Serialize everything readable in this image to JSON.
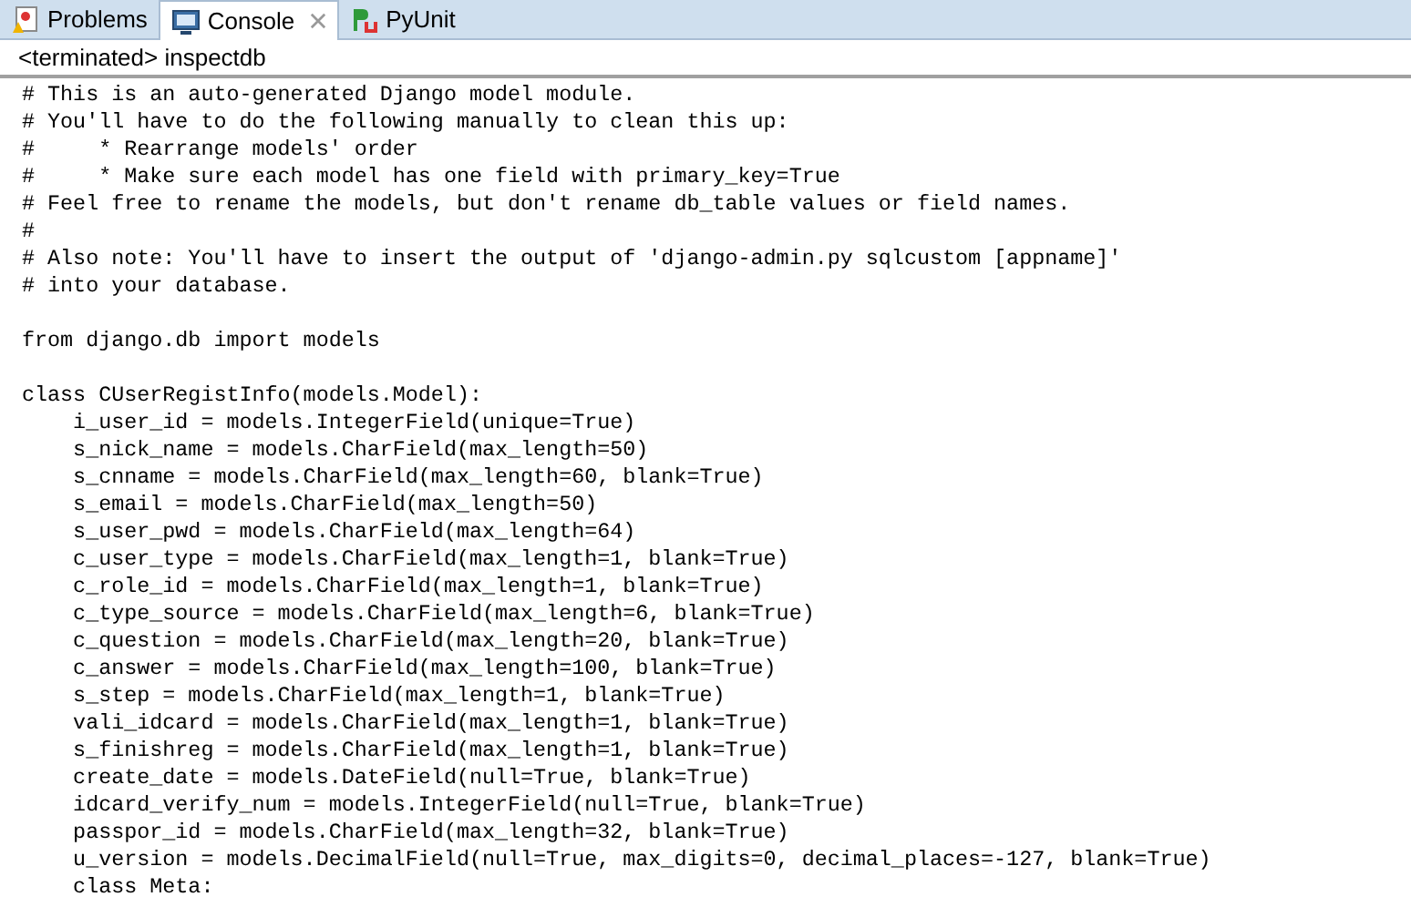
{
  "tabs": [
    {
      "label": "Problems",
      "kind": "problems",
      "selected": false,
      "closable": false
    },
    {
      "label": "Console",
      "kind": "console",
      "selected": true,
      "closable": true
    },
    {
      "label": "PyUnit",
      "kind": "pyunit",
      "selected": false,
      "closable": false
    }
  ],
  "console_title": "<terminated> inspectdb",
  "blocks": [
    [
      "# This is an auto-generated Django model module.",
      "# You'll have to do the following manually to clean this up:",
      "#     * Rearrange models' order",
      "#     * Make sure each model has one field with primary_key=True",
      "# Feel free to rename the models, but don't rename db_table values or field names.",
      "#",
      "# Also note: You'll have to insert the output of 'django-admin.py sqlcustom [appname]'",
      "# into your database."
    ],
    [
      "from django.db import models"
    ],
    [
      "class CUserRegistInfo(models.Model):",
      "    i_user_id = models.IntegerField(unique=True)",
      "    s_nick_name = models.CharField(max_length=50)",
      "    s_cnname = models.CharField(max_length=60, blank=True)",
      "    s_email = models.CharField(max_length=50)",
      "    s_user_pwd = models.CharField(max_length=64)",
      "    c_user_type = models.CharField(max_length=1, blank=True)",
      "    c_role_id = models.CharField(max_length=1, blank=True)",
      "    c_type_source = models.CharField(max_length=6, blank=True)",
      "    c_question = models.CharField(max_length=20, blank=True)",
      "    c_answer = models.CharField(max_length=100, blank=True)",
      "    s_step = models.CharField(max_length=1, blank=True)",
      "    vali_idcard = models.CharField(max_length=1, blank=True)",
      "    s_finishreg = models.CharField(max_length=1, blank=True)",
      "    create_date = models.DateField(null=True, blank=True)",
      "    idcard_verify_num = models.IntegerField(null=True, blank=True)",
      "    passpor_id = models.CharField(max_length=32, blank=True)",
      "    u_version = models.DecimalField(null=True, max_digits=0, decimal_places=-127, blank=True)",
      "    class Meta:"
    ]
  ]
}
